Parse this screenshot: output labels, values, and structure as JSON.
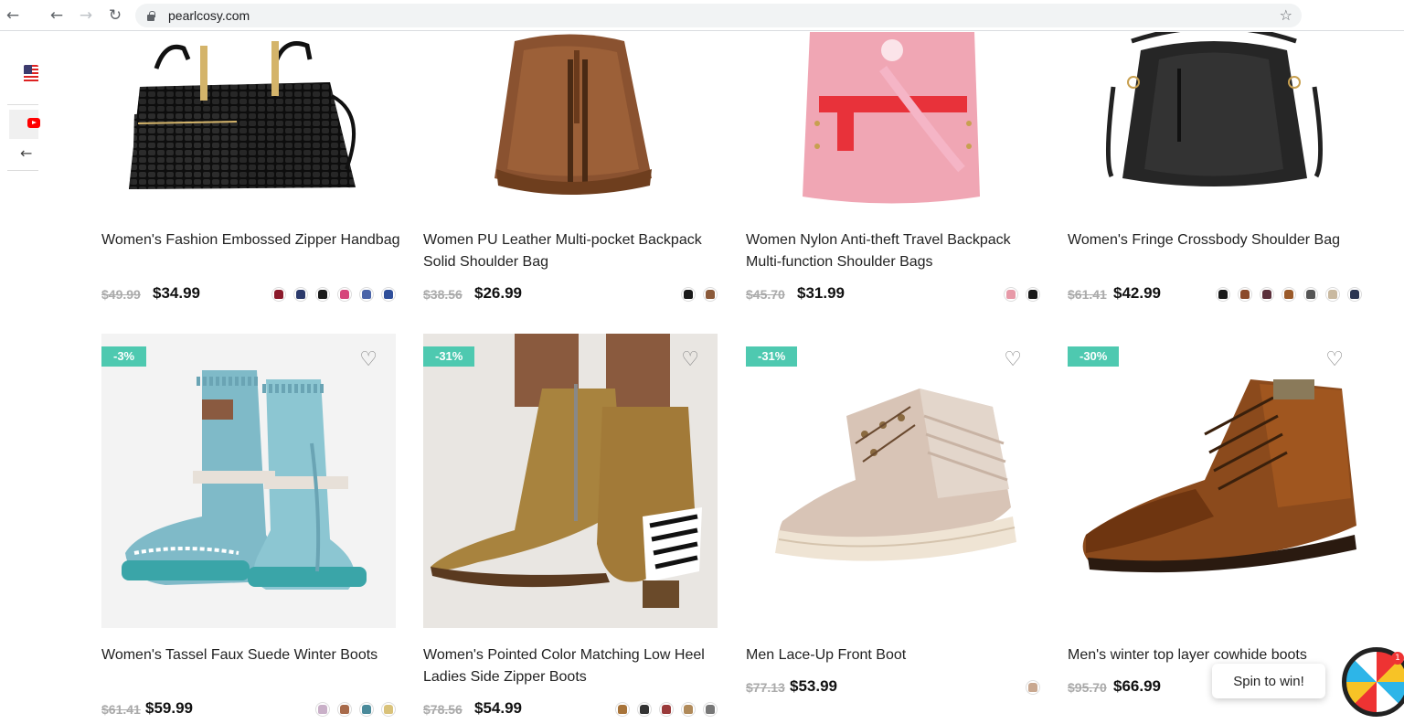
{
  "browser": {
    "url": "pearlcosy.com",
    "back_icon": "←",
    "forward_icon": "→",
    "reload_icon": "↻",
    "bookmark_icon": "☆"
  },
  "products": [
    {
      "name": "Women's Fashion Embossed Zipper Handbag",
      "old_price": "$49.99",
      "price": "$34.99",
      "badge": "",
      "image": "black-croc-handbag",
      "swatches": [
        "#8b1a2b",
        "#2b3a6b",
        "#1a1a1a",
        "#d6457a",
        "#4a64a8",
        "#2f4f9a"
      ]
    },
    {
      "name": "Women PU Leather Multi-pocket Backpack Solid Shoulder Bag",
      "old_price": "$38.56",
      "price": "$26.99",
      "badge": "",
      "image": "brown-backpack",
      "swatches": [
        "#1a1a1a",
        "#8b5a3a"
      ]
    },
    {
      "name": "Women Nylon Anti-theft Travel Backpack Multi-function Shoulder Bags",
      "old_price": "$45.70",
      "price": "$31.99",
      "badge": "",
      "image": "pink-backpack",
      "swatches": [
        "#e79aa8",
        "#1a1a1a"
      ]
    },
    {
      "name": "Women's Fringe Crossbody Shoulder Bag",
      "old_price": "$61.41",
      "price": "$42.99",
      "badge": "",
      "image": "black-hobo-bag",
      "swatches": [
        "#1a1a1a",
        "#8b4a2a",
        "#5a2f3a",
        "#9a5a2a",
        "#555",
        "#c9b9a0",
        "#2a3552"
      ]
    },
    {
      "name": "Women's Tassel Faux Suede Winter Boots",
      "old_price": "$61.41",
      "price": "$59.99",
      "badge": "-3%",
      "image": "blue-tassel-boots",
      "swatches": [
        "#c9b0c8",
        "#a86a4a",
        "#4a8a9a",
        "#d9c27a"
      ]
    },
    {
      "name": "Women's Pointed Color Matching Low Heel Ladies Side Zipper Boots",
      "old_price": "$78.56",
      "price": "$54.99",
      "badge": "-31%",
      "image": "tan-zebra-boots",
      "swatches": [
        "#a8743a",
        "#333",
        "#9a3a3a",
        "#b08a5a",
        "#777"
      ]
    },
    {
      "name": "Men Lace-Up Front Boot",
      "old_price": "$77.13",
      "price": "$53.99",
      "badge": "-31%",
      "image": "beige-lace-boot",
      "swatches": [
        "#c9a890"
      ]
    },
    {
      "name": "Men's winter top layer cowhide boots",
      "old_price": "$95.70",
      "price": "$66.99",
      "badge": "-30%",
      "image": "brown-brogue-boot",
      "swatches": [
        "#1a1a1a"
      ]
    }
  ],
  "heart_icon": "♡",
  "spin": {
    "label": "Spin to win!",
    "count": "1"
  }
}
